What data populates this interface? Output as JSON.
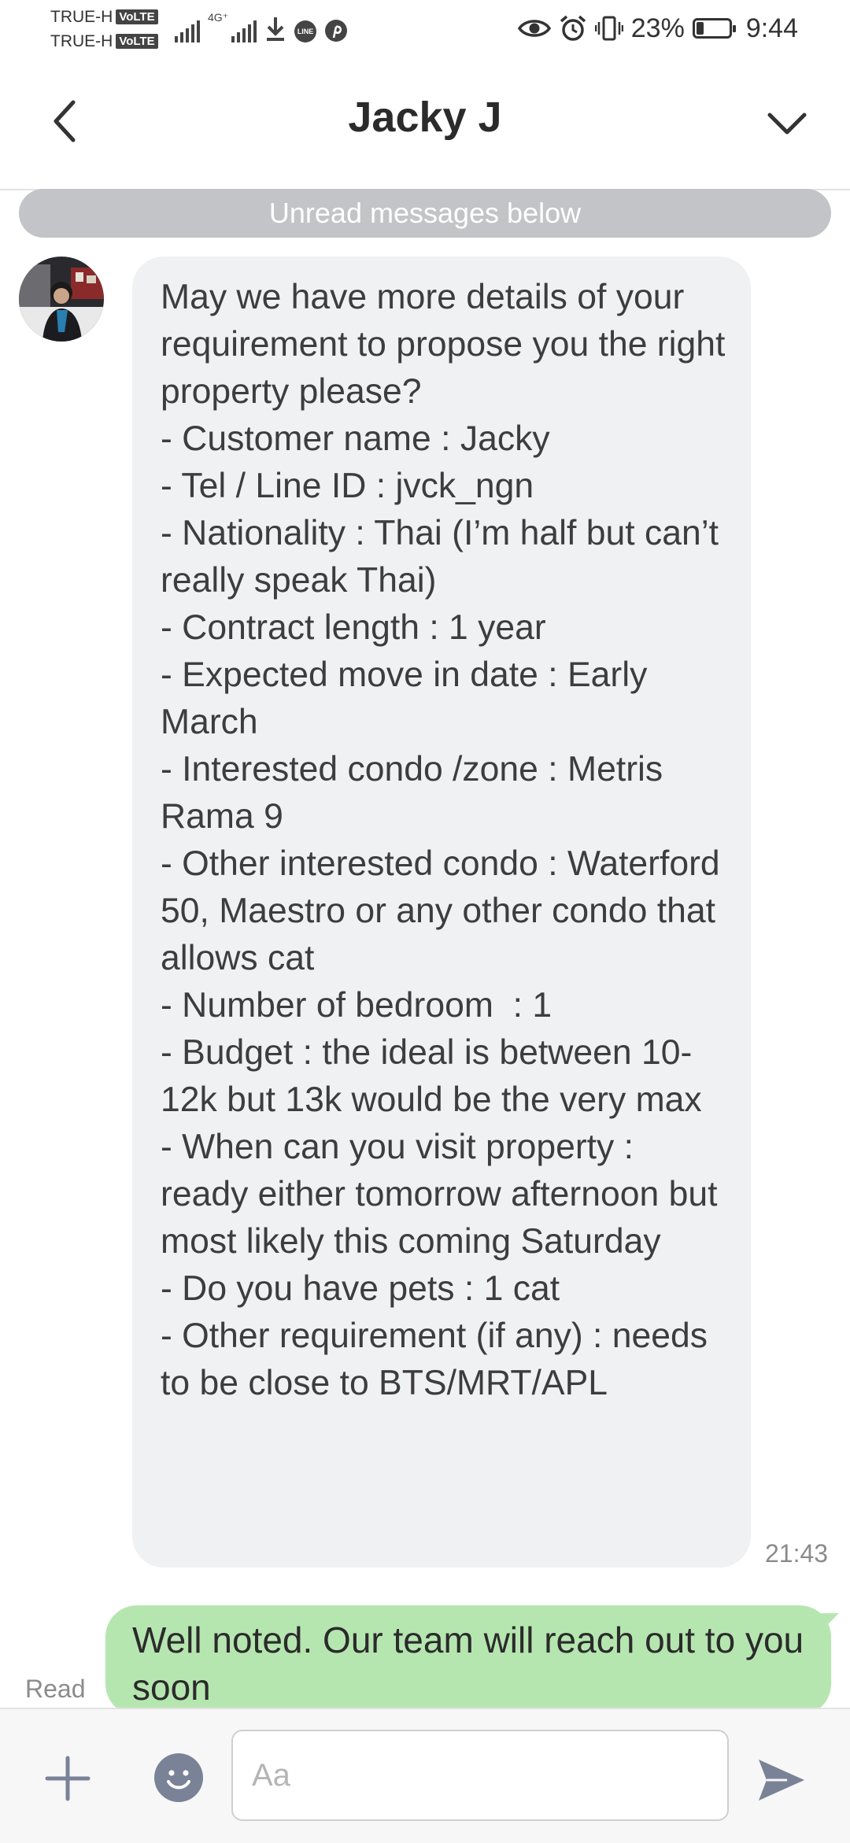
{
  "status_bar": {
    "carrier_1": "TRUE-H",
    "carrier_2": "TRUE-H",
    "volte_badge": "VoLTE",
    "network_type": "4G⁺",
    "line_badge": "LINE",
    "battery_percent": "23%",
    "battery_level": 0.23,
    "time": "9:44"
  },
  "header": {
    "title": "Jacky J"
  },
  "unread_banner": "Unread messages below",
  "messages": [
    {
      "direction": "incoming",
      "text": "May we have more details of your requirement to propose you the right property please?\n- Customer name : Jacky\n- Tel / Line ID : jvck_ngn\n- Nationality : Thai (I’m half but can’t really speak Thai)\n- Contract length : 1 year\n- Expected move in date : Early March\n- Interested condo /zone : Metris Rama 9\n- Other interested condo : Waterford 50, Maestro or any other condo that allows cat\n- Number of bedroom  : 1\n- Budget : the ideal is between 10-12k but 13k would be the very max\n- When can you visit property : ready either tomorrow afternoon but most likely this coming Saturday\n- Do you have pets : 1 cat\n- Other requirement (if any) : needs to be close to BTS/MRT/APL",
      "time": "21:43"
    },
    {
      "direction": "outgoing",
      "text": "Well noted. Our team will reach out to you soon",
      "status": "Read"
    }
  ],
  "input": {
    "placeholder": "Aa"
  },
  "colors": {
    "incoming_bubble": "#f0f1f3",
    "outgoing_bubble": "#b6e6b0",
    "banner": "#c3c4c7",
    "icon_gray": "#7a8297"
  }
}
